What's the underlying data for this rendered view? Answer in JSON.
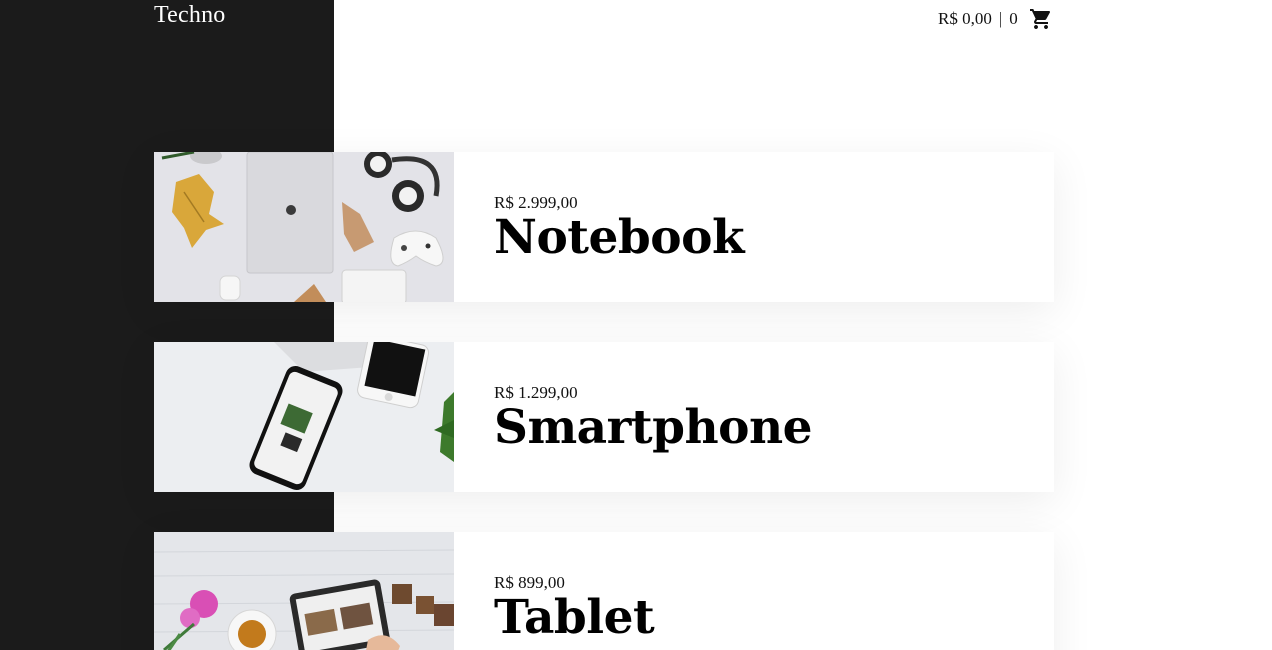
{
  "header": {
    "logo": "Techno",
    "cart": {
      "total": "R$ 0,00",
      "separator": "|",
      "count": "0",
      "icon": "shopping-cart-icon"
    }
  },
  "products": [
    {
      "price": "R$ 2.999,00",
      "name": "Notebook"
    },
    {
      "price": "R$ 1.299,00",
      "name": "Smartphone"
    },
    {
      "price": "R$ 899,00",
      "name": "Tablet"
    }
  ],
  "colors": {
    "sidebar_band": "#1b1b1b",
    "page_background": "#ffffff",
    "text": "#000000"
  }
}
